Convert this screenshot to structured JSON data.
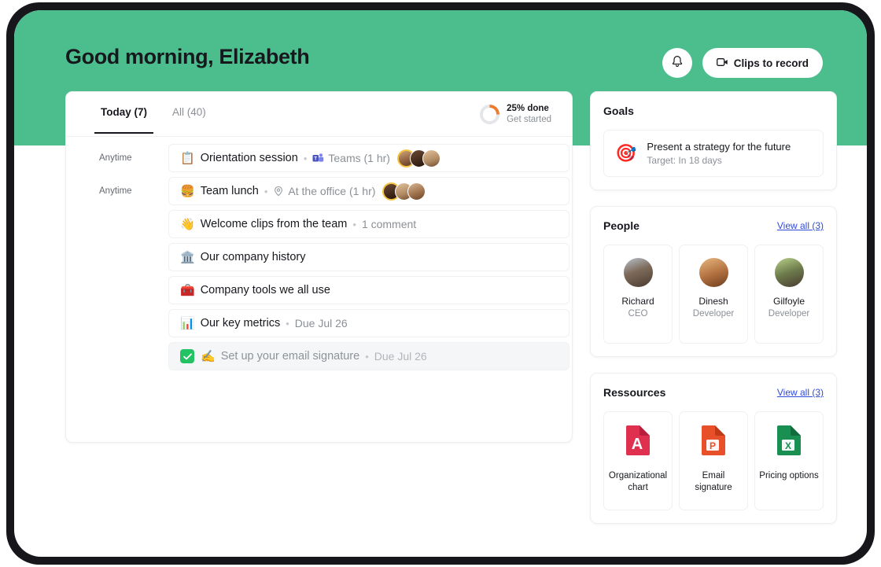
{
  "header": {
    "greeting": "Good morning, Elizabeth",
    "bell_icon": "bell-icon",
    "clips_button": "Clips to record",
    "clips_icon": "video-camera-icon"
  },
  "colors": {
    "brand_green": "#4cbe8e",
    "frame_black": "#17161a",
    "progress_orange": "#ef7c2e",
    "check_green": "#23c363",
    "link_blue": "#2f4bd8"
  },
  "tasks_panel": {
    "tabs": [
      {
        "label": "Today (7)",
        "active": true
      },
      {
        "label": "All (40)",
        "active": false
      }
    ],
    "progress": {
      "percent_label": "25% done",
      "sub_label": "Get started",
      "percent_value": 25
    },
    "rows": [
      {
        "when": "Anytime",
        "emoji": "📋",
        "emoji_name": "clipboard-emoji",
        "title": "Orientation session",
        "meta": "Teams (1 hr)",
        "meta_icon": "microsoft-teams-icon",
        "avatars": 3,
        "done": false
      },
      {
        "when": "Anytime",
        "emoji": "🍔",
        "emoji_name": "hamburger-emoji",
        "title": "Team lunch",
        "meta": "At the office (1 hr)",
        "meta_icon": "location-pin-icon",
        "avatars": 3,
        "done": false
      },
      {
        "when": "",
        "emoji": "👋",
        "emoji_name": "waving-hand-emoji",
        "title": "Welcome clips from the team",
        "meta": "1 comment",
        "meta_icon": "",
        "avatars": 0,
        "done": false
      },
      {
        "when": "",
        "emoji": "🏛️",
        "emoji_name": "classical-building-emoji",
        "title": "Our company history",
        "meta": "",
        "meta_icon": "",
        "avatars": 0,
        "done": false
      },
      {
        "when": "",
        "emoji": "🧰",
        "emoji_name": "toolbox-emoji",
        "title": "Company tools we all use",
        "meta": "",
        "meta_icon": "",
        "avatars": 0,
        "done": false
      },
      {
        "when": "",
        "emoji": "📊",
        "emoji_name": "bar-chart-emoji",
        "title": "Our key metrics",
        "meta": "Due Jul 26",
        "meta_icon": "",
        "avatars": 0,
        "done": false
      },
      {
        "when": "",
        "emoji": "✍️",
        "emoji_name": "writing-hand-emoji",
        "title": "Set up your email signature",
        "meta": "Due Jul 26",
        "meta_icon": "",
        "avatars": 0,
        "done": true
      }
    ]
  },
  "goals": {
    "title": "Goals",
    "items": [
      {
        "emoji": "🎯",
        "emoji_name": "dart-target-emoji",
        "name": "Present a strategy for the future",
        "target": "Target: In 18 days"
      }
    ]
  },
  "people": {
    "title": "People",
    "view_all": "View all (3)",
    "items": [
      {
        "name": "Richard",
        "role": "CEO"
      },
      {
        "name": "Dinesh",
        "role": "Developer"
      },
      {
        "name": "Gilfoyle",
        "role": "Developer"
      }
    ]
  },
  "resources": {
    "title": "Ressources",
    "view_all": "View all (3)",
    "items": [
      {
        "label": "Organizational chart",
        "file_icon": "pdf-file-icon"
      },
      {
        "label": "Email signature",
        "file_icon": "powerpoint-file-icon"
      },
      {
        "label": "Pricing options",
        "file_icon": "excel-file-icon"
      }
    ]
  }
}
